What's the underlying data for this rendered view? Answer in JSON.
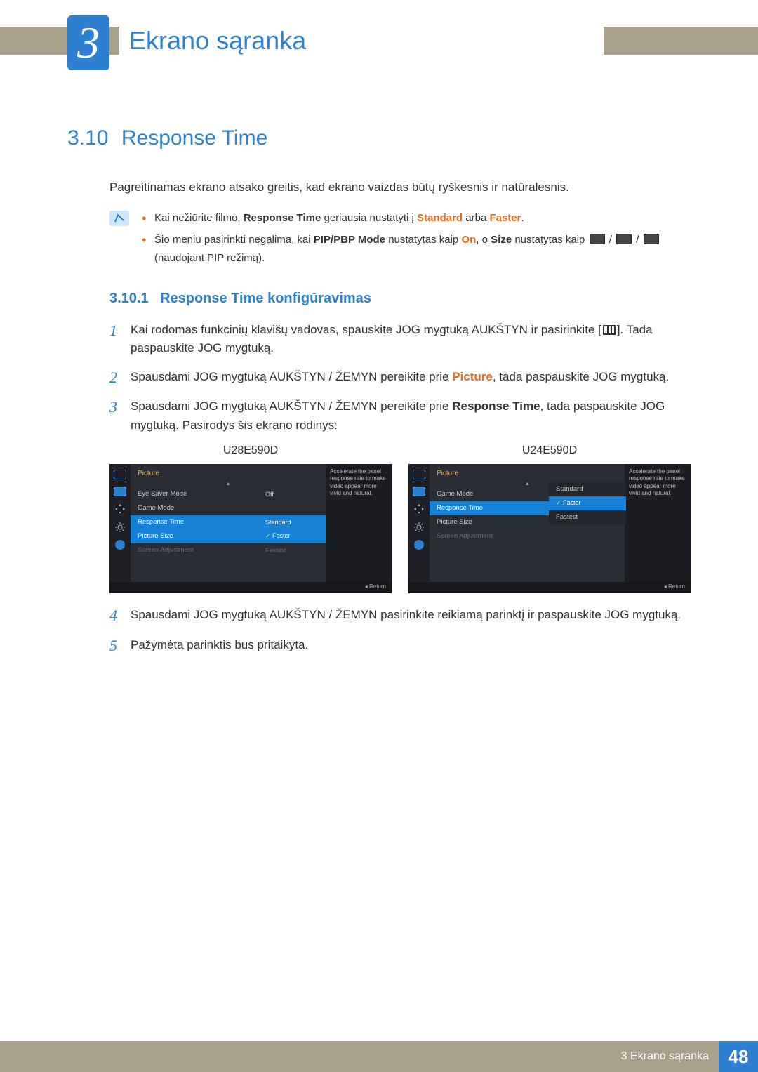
{
  "chapter": {
    "number": "3",
    "title": "Ekrano sąranka"
  },
  "section": {
    "number": "3.10",
    "title": "Response Time"
  },
  "intro": "Pagreitinamas ekrano atsako greitis, kad ekrano vaizdas būtų ryškesnis ir natūralesnis.",
  "notes": {
    "n1a": "Kai nežiūrite filmo, ",
    "n1b": "Response Time",
    "n1c": " geriausia nustatyti į ",
    "n1d": "Standard",
    "n1e": " arba ",
    "n1f": "Faster",
    "n1g": ".",
    "n2a": "Šio meniu pasirinkti negalima, kai ",
    "n2b": "PIP/PBP Mode",
    "n2c": " nustatytas kaip ",
    "n2d": "On",
    "n2e": ", o ",
    "n2f": "Size",
    "n2g": " nustatytas kaip ",
    "n2h": " (naudojant PIP režimą)."
  },
  "subsection": {
    "number": "3.10.1",
    "title": "Response Time konfigūravimas"
  },
  "steps": {
    "s1a": "Kai rodomas funkcinių klavišų vadovas, spauskite JOG mygtuką AUKŠTYN ir pasirinkite [",
    "s1b": "]. Tada paspauskite JOG mygtuką.",
    "s2a": "Spausdami JOG mygtuką AUKŠTYN / ŽEMYN pereikite prie ",
    "s2b": "Picture",
    "s2c": ", tada paspauskite JOG mygtuką.",
    "s3a": "Spausdami JOG mygtuką AUKŠTYN / ŽEMYN pereikite prie ",
    "s3b": "Response Time",
    "s3c": ", tada paspauskite JOG mygtuką. Pasirodys šis ekrano rodinys:",
    "s4": "Spausdami JOG mygtuką AUKŠTYN / ŽEMYN pasirinkite reikiamą parinktį ir paspauskite JOG mygtuką.",
    "s5": "Pažymėta parinktis bus pritaikyta."
  },
  "models": {
    "left": "U28E590D",
    "right": "U24E590D"
  },
  "osd": {
    "desc": "Accelerate the panel response rate to make video appear more vivid and natural.",
    "return": "Return",
    "picture": "Picture",
    "left": {
      "rows": [
        {
          "lab": "Eye Saver Mode",
          "val": "Off"
        },
        {
          "lab": "Game Mode",
          "val": ""
        },
        {
          "lab": "Response Time",
          "val": "Standard",
          "sel": true
        },
        {
          "lab": "Picture Size",
          "val": "Faster",
          "opt": true,
          "optsel": true
        },
        {
          "lab": "Screen Adjustment",
          "val": "Fastest",
          "dim": true
        }
      ]
    },
    "right": {
      "rows": [
        {
          "lab": "Game Mode"
        },
        {
          "lab": "Response Time",
          "sel": true
        },
        {
          "lab": "Picture Size"
        },
        {
          "lab": "Screen Adjustment",
          "dim": true
        }
      ],
      "opts": [
        {
          "lab": "Standard"
        },
        {
          "lab": "Faster",
          "sel": true
        },
        {
          "lab": "Fastest"
        }
      ]
    }
  },
  "footer": {
    "label": "3 Ekrano sąranka",
    "page": "48"
  }
}
